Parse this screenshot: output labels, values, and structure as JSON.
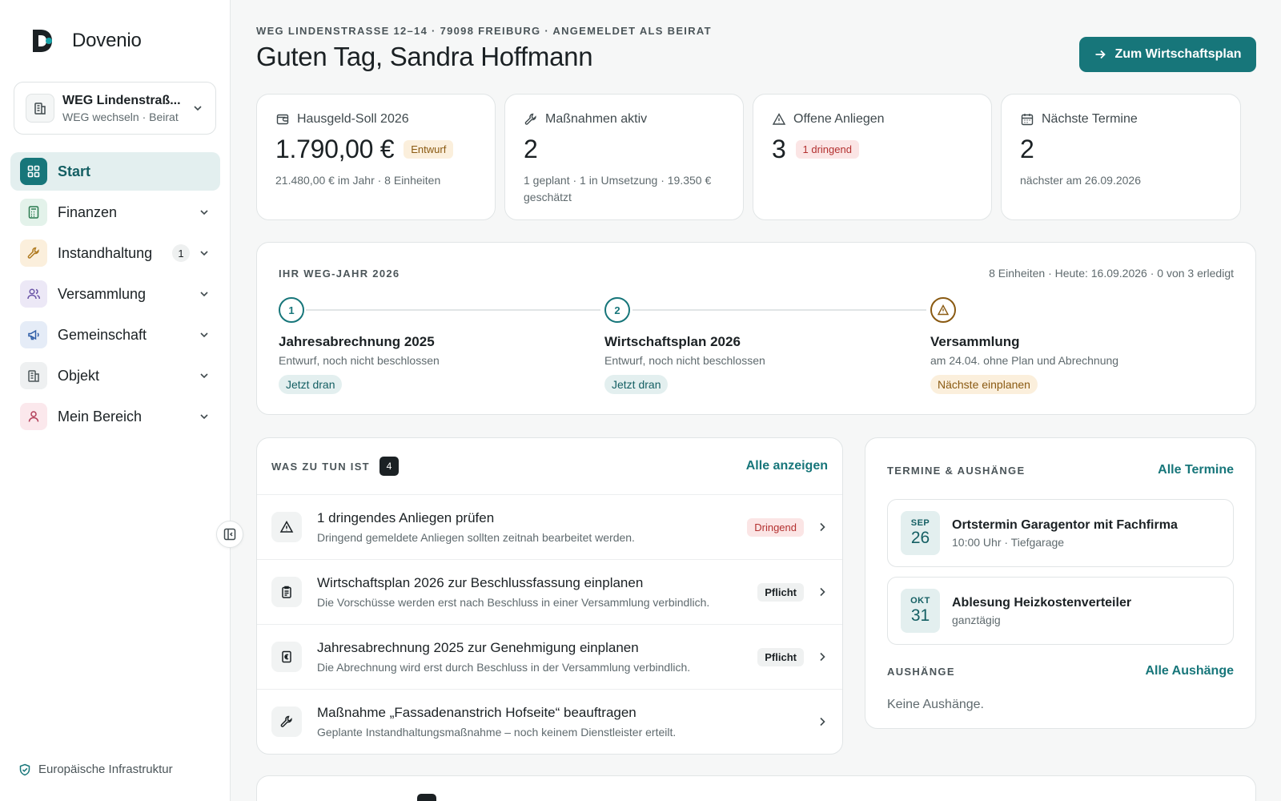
{
  "brand": {
    "name": "Dovenio"
  },
  "weg_switcher": {
    "title": "WEG Lindenstraß...",
    "subtitle": "WEG wechseln · Beirat"
  },
  "nav": [
    {
      "label": "Start",
      "icon": "dashboard-icon",
      "active": true
    },
    {
      "label": "Finanzen",
      "icon": "calculator-icon"
    },
    {
      "label": "Instandhaltung",
      "icon": "wrench-icon",
      "badge": "1"
    },
    {
      "label": "Versammlung",
      "icon": "users-icon"
    },
    {
      "label": "Gemeinschaft",
      "icon": "megaphone-icon"
    },
    {
      "label": "Objekt",
      "icon": "building-icon"
    },
    {
      "label": "Mein Bereich",
      "icon": "user-icon"
    }
  ],
  "sidebar_footer": "Europäische Infrastruktur",
  "header": {
    "eyebrow": "WEG LINDENSTRASSE 12–14 · 79098 FREIBURG · ANGEMELDET ALS BEIRAT",
    "greeting": "Guten Tag, Sandra Hoffmann",
    "cta": "Zum Wirtschaftsplan"
  },
  "kpis": [
    {
      "label": "Hausgeld-Soll 2026",
      "icon": "wallet-icon",
      "value": "1.790,00 €",
      "badge": "Entwurf",
      "sub": "21.480,00 € im Jahr · 8 Einheiten"
    },
    {
      "label": "Maßnahmen aktiv",
      "icon": "wrench-icon",
      "value": "2",
      "sub": "1 geplant · 1 in Umsetzung · 19.350 € geschätzt"
    },
    {
      "label": "Offene Anliegen",
      "icon": "warning-icon",
      "value": "3",
      "badge": "1 dringend",
      "sub": ""
    },
    {
      "label": "Nächste Termine",
      "icon": "calendar-icon",
      "value": "2",
      "sub": "nächster am 26.09.2026"
    }
  ],
  "year": {
    "title": "IHR WEG-JAHR 2026",
    "meta": "8 Einheiten · Heute: 16.09.2026 · 0 von 3 erledigt",
    "steps": [
      {
        "num": "1",
        "title": "Jahresabrechnung 2025",
        "sub": "Entwurf, noch nicht beschlossen",
        "chip": "Jetzt dran"
      },
      {
        "num": "2",
        "title": "Wirtschaftsplan 2026",
        "sub": "Entwurf, noch nicht beschlossen",
        "chip": "Jetzt dran"
      },
      {
        "num": "",
        "title": "Versammlung",
        "sub": "am 24.04. ohne Plan und Abrechnung",
        "chip": "Nächste einplanen"
      }
    ]
  },
  "todo": {
    "title": "WAS ZU TUN IST",
    "count": "4",
    "link": "Alle anzeigen",
    "items": [
      {
        "icon": "warning-icon",
        "title": "1 dringendes Anliegen prüfen",
        "sub": "Dringend gemeldete Anliegen sollten zeitnah bearbeitet werden.",
        "badge": "Dringend"
      },
      {
        "icon": "clipboard-icon",
        "title": "Wirtschaftsplan 2026 zur Beschlussfassung einplanen",
        "sub": "Die Vorschüsse werden erst nach Beschluss in einer Versammlung verbindlich.",
        "badge": "Pflicht"
      },
      {
        "icon": "euro-document-icon",
        "title": "Jahresabrechnung 2025 zur Genehmigung einplanen",
        "sub": "Die Abrechnung wird erst durch Beschluss in der Versammlung verbindlich.",
        "badge": "Pflicht"
      },
      {
        "icon": "wrench-icon",
        "title": "Maßnahme „Fassadenanstrich Hofseite“ beauftragen",
        "sub": "Geplante Instandhaltungsmaßnahme – noch keinem Dienstleister erteilt.",
        "badge": ""
      }
    ]
  },
  "termine": {
    "title": "TERMINE & AUSHÄNGE",
    "link": "Alle Termine",
    "events": [
      {
        "month": "SEP",
        "day": "26",
        "title": "Ortstermin Garagentor mit Fachfirma",
        "sub": "10:00 Uhr · Tiefgarage"
      },
      {
        "month": "OKT",
        "day": "31",
        "title": "Ablesung Heizkostenverteiler",
        "sub": "ganztägig"
      }
    ],
    "aushaenge_title": "AUSHÄNGE",
    "aushaenge_link": "Alle Aushänge",
    "aushaenge_empty": "Keine Aushänge."
  },
  "colors": {
    "accent": "#17767a",
    "accent_soft": "#e3efef",
    "amber": "#8a5a12",
    "red": "#b3302f"
  }
}
